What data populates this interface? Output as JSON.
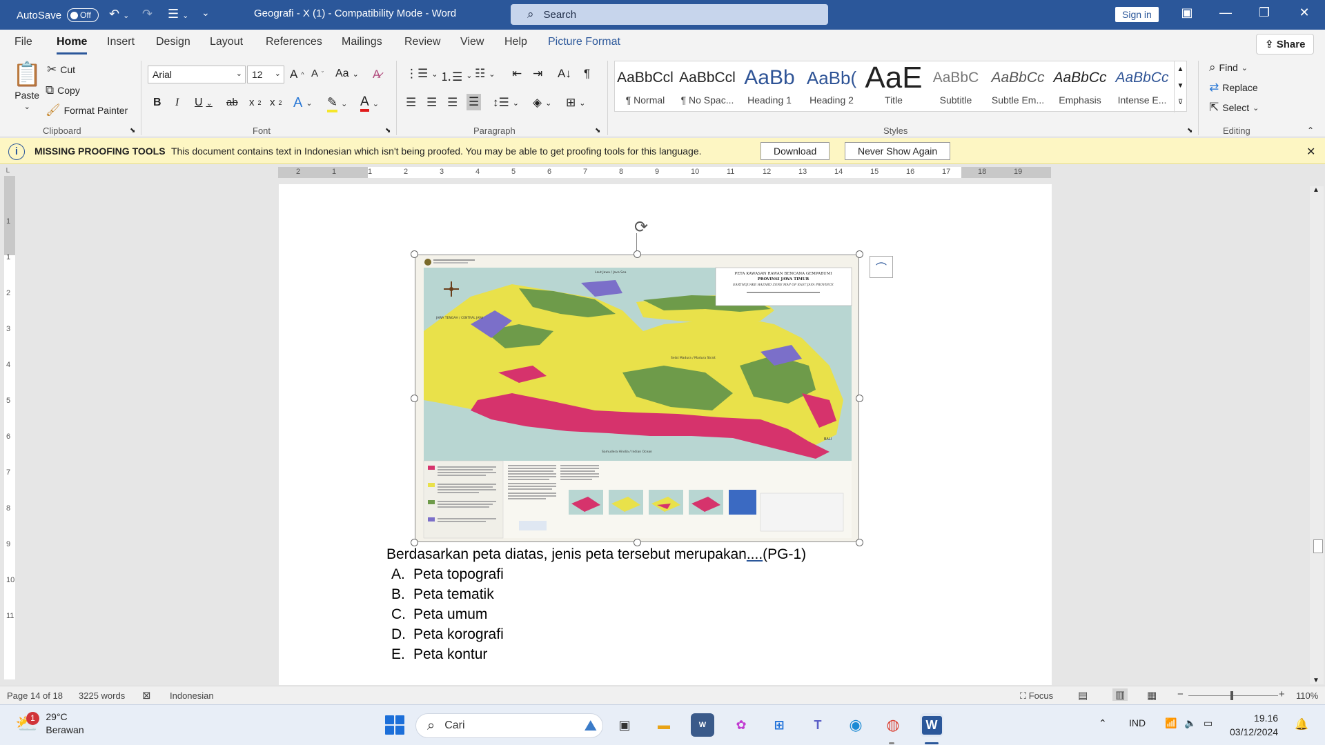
{
  "titlebar": {
    "autosave_label": "AutoSave",
    "autosave_state": "Off",
    "doc_title": "Geografi - X (1)  -  Compatibility Mode  -  Word",
    "search_placeholder": "Search",
    "signin": "Sign in"
  },
  "tabs": [
    "File",
    "Home",
    "Insert",
    "Design",
    "Layout",
    "References",
    "Mailings",
    "Review",
    "View",
    "Help",
    "Picture Format"
  ],
  "share": "Share",
  "ribbon": {
    "clipboard": {
      "paste": "Paste",
      "cut": "Cut",
      "copy": "Copy",
      "format_painter": "Format Painter",
      "label": "Clipboard"
    },
    "font": {
      "name": "Arial",
      "size": "12",
      "label": "Font",
      "change_case": "Aa"
    },
    "paragraph": {
      "label": "Paragraph"
    },
    "styles": {
      "label": "Styles",
      "items": [
        {
          "preview": "AaBbCcl",
          "name": "¶ Normal"
        },
        {
          "preview": "AaBbCcl",
          "name": "¶ No Spac..."
        },
        {
          "preview": "AaBb",
          "name": "Heading 1"
        },
        {
          "preview": "AaBb(",
          "name": "Heading 2"
        },
        {
          "preview": "AaE",
          "name": "Title"
        },
        {
          "preview": "AaBbC",
          "name": "Subtitle"
        },
        {
          "preview": "AaBbCc",
          "name": "Subtle Em..."
        },
        {
          "preview": "AaBbCc",
          "name": "Emphasis"
        },
        {
          "preview": "AaBbCc",
          "name": "Intense E..."
        }
      ]
    },
    "editing": {
      "find": "Find",
      "replace": "Replace",
      "select": "Select",
      "label": "Editing"
    }
  },
  "message_bar": {
    "title": "MISSING PROOFING TOOLS",
    "text": "This document contains text in Indonesian which isn't being proofed. You may be able to get proofing tools for this language.",
    "download": "Download",
    "never_show": "Never Show Again"
  },
  "ruler": {
    "h_ticks": [
      "2",
      "1",
      "1",
      "2",
      "3",
      "4",
      "5",
      "6",
      "7",
      "8",
      "9",
      "10",
      "11",
      "12",
      "13",
      "14",
      "15",
      "16",
      "17",
      "18",
      "19"
    ],
    "v_ticks": [
      "1",
      "1",
      "2",
      "3",
      "4",
      "5",
      "6",
      "7",
      "8",
      "9",
      "10",
      "11"
    ]
  },
  "document": {
    "map": {
      "title_line1": "PETA KAWASAN RAWAN BENCANA GEMPABUMI",
      "title_line2": "PROVINSI JAWA TIMUR",
      "title_line3": "EARTHQUAKE HAZARD ZONE MAP OF EAST JAVA PROVINCE",
      "left_region": "JAWA TENGAH / CENTRAL JAVA",
      "sea_north": "Laut Jawa / Java Sea",
      "strait": "Selat Madura / Madura Strait",
      "ocean": "Samudera Hindia / Indian Ocean",
      "bali": "BALI"
    },
    "question_main": "Berdasarkan peta diatas, jenis peta tersebut merupakan",
    "question_dots": "....",
    "question_tag": "(PG-1)",
    "options": [
      {
        "letter": "A.",
        "text": "Peta topografi"
      },
      {
        "letter": "B.",
        "text": "Peta tematik"
      },
      {
        "letter": "C.",
        "text": "Peta umum"
      },
      {
        "letter": "D.",
        "text": "Peta korografi"
      },
      {
        "letter": "E.",
        "text": "Peta kontur"
      }
    ]
  },
  "status": {
    "page": "Page 14 of 18",
    "words": "3225 words",
    "language": "Indonesian",
    "focus": "Focus",
    "zoom": "110%"
  },
  "taskbar": {
    "temp": "29°C",
    "weather": "Berawan",
    "badge": "1",
    "search": "Cari",
    "lang": "IND",
    "time": "19.16",
    "date": "03/12/2024"
  },
  "colors": {
    "word_blue": "#2b579a",
    "message_bar": "#fdf6c3",
    "map_yellow": "#e9e14a",
    "map_magenta": "#d6336c",
    "map_green": "#6e9b4a",
    "map_purple": "#7b6fc9",
    "map_sea": "#b8d6d2"
  }
}
